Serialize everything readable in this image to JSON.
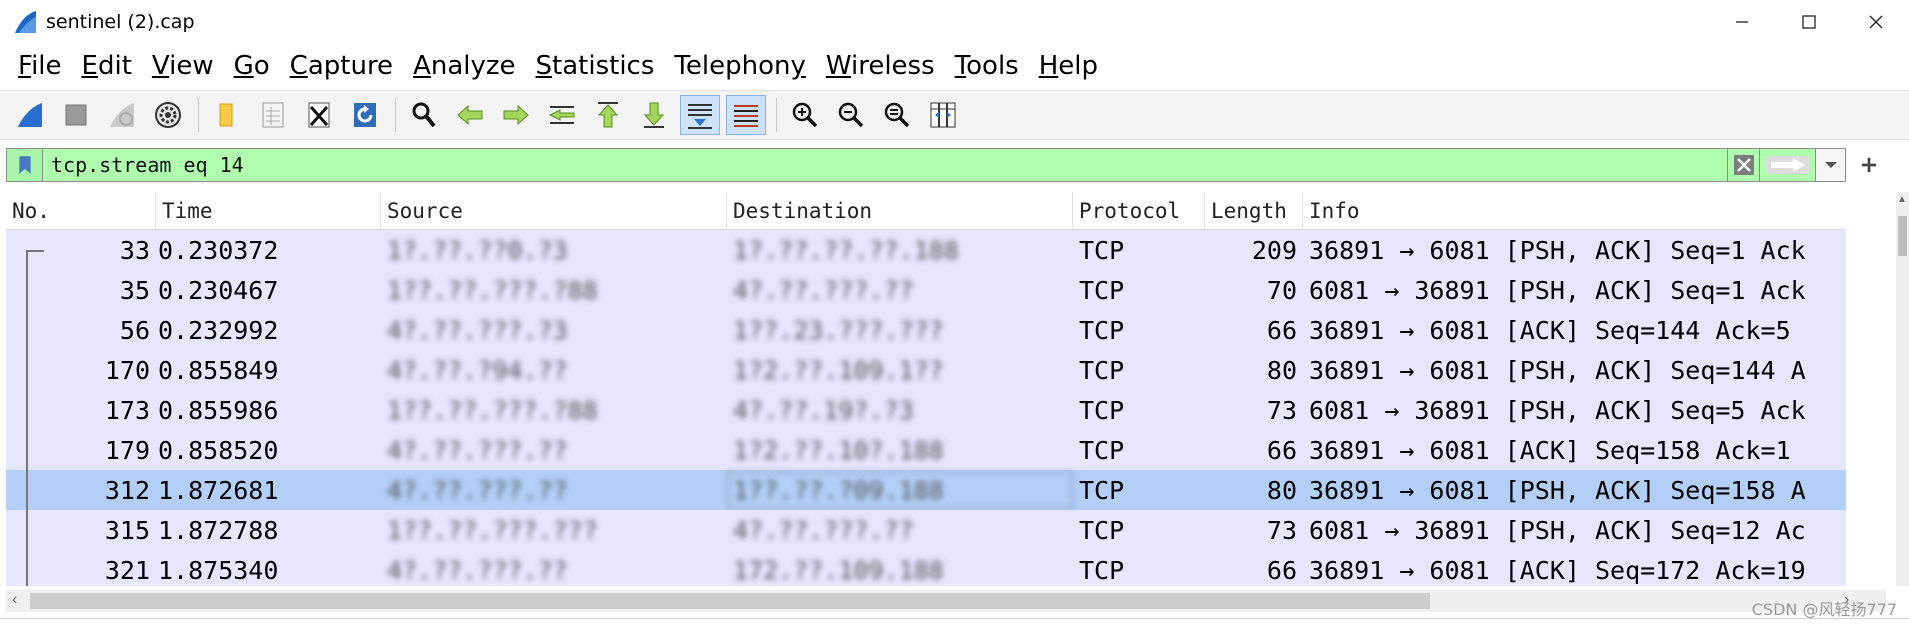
{
  "window": {
    "title": "sentinel (2).cap"
  },
  "menu": [
    {
      "label": "File",
      "accel": "F",
      "rest": "ile"
    },
    {
      "label": "Edit",
      "accel": "E",
      "rest": "dit"
    },
    {
      "label": "View",
      "accel": "V",
      "rest": "iew"
    },
    {
      "label": "Go",
      "accel": "G",
      "rest": "o"
    },
    {
      "label": "Capture",
      "accel": "C",
      "rest": "apture"
    },
    {
      "label": "Analyze",
      "accel": "A",
      "rest": "nalyze"
    },
    {
      "label": "Statistics",
      "accel": "S",
      "rest": "tatistics"
    },
    {
      "label": "Telephony",
      "pre": "Telephon",
      "accel": "y",
      "rest": ""
    },
    {
      "label": "Wireless",
      "accel": "W",
      "rest": "ireless"
    },
    {
      "label": "Tools",
      "accel": "T",
      "rest": "ools"
    },
    {
      "label": "Help",
      "accel": "H",
      "rest": "elp"
    }
  ],
  "filter": {
    "value": "tcp.stream eq 14"
  },
  "columns": [
    "No.",
    "Time",
    "Source",
    "Destination",
    "Protocol",
    "Length",
    "Info"
  ],
  "packets": [
    {
      "no": "33",
      "time": "0.230372",
      "source": "1?.??.??0.?3",
      "destination": "1?.??.??.??.188",
      "protocol": "TCP",
      "length": "209",
      "info": "36891 → 6081 [PSH, ACK] Seq=1 Ack"
    },
    {
      "no": "35",
      "time": "0.230467",
      "source": "1??.??.???.?88",
      "destination": "4?.??.???.??",
      "protocol": "TCP",
      "length": "70",
      "info": "6081 → 36891 [PSH, ACK] Seq=1 Ack"
    },
    {
      "no": "56",
      "time": "0.232992",
      "source": "4?.??.???.?3",
      "destination": "1??.23.???.???",
      "protocol": "TCP",
      "length": "66",
      "info": "36891 → 6081 [ACK] Seq=144 Ack=5"
    },
    {
      "no": "170",
      "time": "0.855849",
      "source": "4?.??.?94.??",
      "destination": "1?2.??.109.1??",
      "protocol": "TCP",
      "length": "80",
      "info": "36891 → 6081 [PSH, ACK] Seq=144 A"
    },
    {
      "no": "173",
      "time": "0.855986",
      "source": "1??.??.???.?88",
      "destination": "4?.??.19?.?3",
      "protocol": "TCP",
      "length": "73",
      "info": "6081 → 36891 [PSH, ACK] Seq=5 Ack"
    },
    {
      "no": "179",
      "time": "0.858520",
      "source": "4?.??.???.??",
      "destination": "1?2.??.10?.188",
      "protocol": "TCP",
      "length": "66",
      "info": "36891 → 6081 [ACK] Seq=158 Ack=1"
    },
    {
      "no": "312",
      "time": "1.872681",
      "source": "4?.??.???.??",
      "destination": "1??.??.?09.188",
      "protocol": "TCP",
      "length": "80",
      "info": "36891 → 6081 [PSH, ACK] Seq=158 A"
    },
    {
      "no": "315",
      "time": "1.872788",
      "source": "1??.??.???.???",
      "destination": "4?.??.???.??",
      "protocol": "TCP",
      "length": "73",
      "info": "6081 → 36891 [PSH, ACK] Seq=12 Ac"
    },
    {
      "no": "321",
      "time": "1.875340",
      "source": "4?.??.???.??",
      "destination": "172.??.109.188",
      "protocol": "TCP",
      "length": "66",
      "info": "36891 → 6081 [ACK] Seq=172 Ack=19"
    }
  ],
  "selected_row": 6,
  "watermark": "CSDN @风轻扬777",
  "colors": {
    "row_bg": "#e7e6ff",
    "selected_bg": "#b3cff8",
    "filter_valid_bg": "#afffaf"
  }
}
